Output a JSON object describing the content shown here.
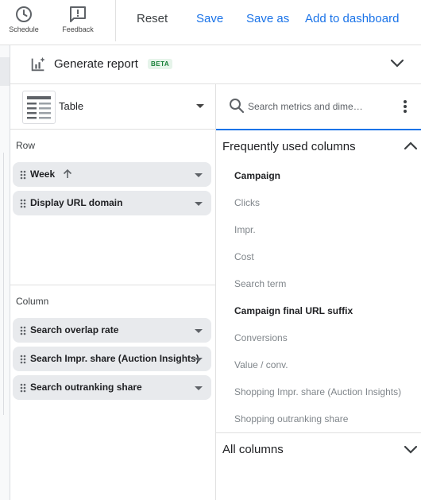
{
  "toolbar": {
    "schedule_label": "Schedule",
    "feedback_label": "Feedback",
    "reset_label": "Reset",
    "save_label": "Save",
    "save_as_label": "Save as",
    "add_dashboard_label": "Add to dashboard",
    "accent_color": "#1a73e8"
  },
  "header": {
    "title": "Generate report",
    "badge": "BETA"
  },
  "builder": {
    "visualization": "Table",
    "row_label": "Row",
    "rows": [
      {
        "label": "Week",
        "sorted": "ascending"
      },
      {
        "label": "Display URL domain"
      }
    ],
    "column_label": "Column",
    "columns": [
      {
        "label": "Search overlap rate"
      },
      {
        "label": "Search Impr. share (Auction Insights)"
      },
      {
        "label": "Search outranking share"
      }
    ]
  },
  "columns_panel": {
    "search_placeholder": "Search metrics and dime…",
    "frequent_title": "Frequently used columns",
    "frequent_items": [
      {
        "label": "Campaign",
        "in_use": true
      },
      {
        "label": "Clicks",
        "in_use": false
      },
      {
        "label": "Impr.",
        "in_use": false
      },
      {
        "label": "Cost",
        "in_use": false
      },
      {
        "label": "Search term",
        "in_use": false
      },
      {
        "label": "Campaign final URL suffix",
        "in_use": true
      },
      {
        "label": "Conversions",
        "in_use": false
      },
      {
        "label": "Value / conv.",
        "in_use": false
      },
      {
        "label": "Shopping Impr. share (Auction Insights)",
        "in_use": false
      },
      {
        "label": "Shopping outranking share",
        "in_use": false
      }
    ],
    "all_title": "All columns"
  }
}
